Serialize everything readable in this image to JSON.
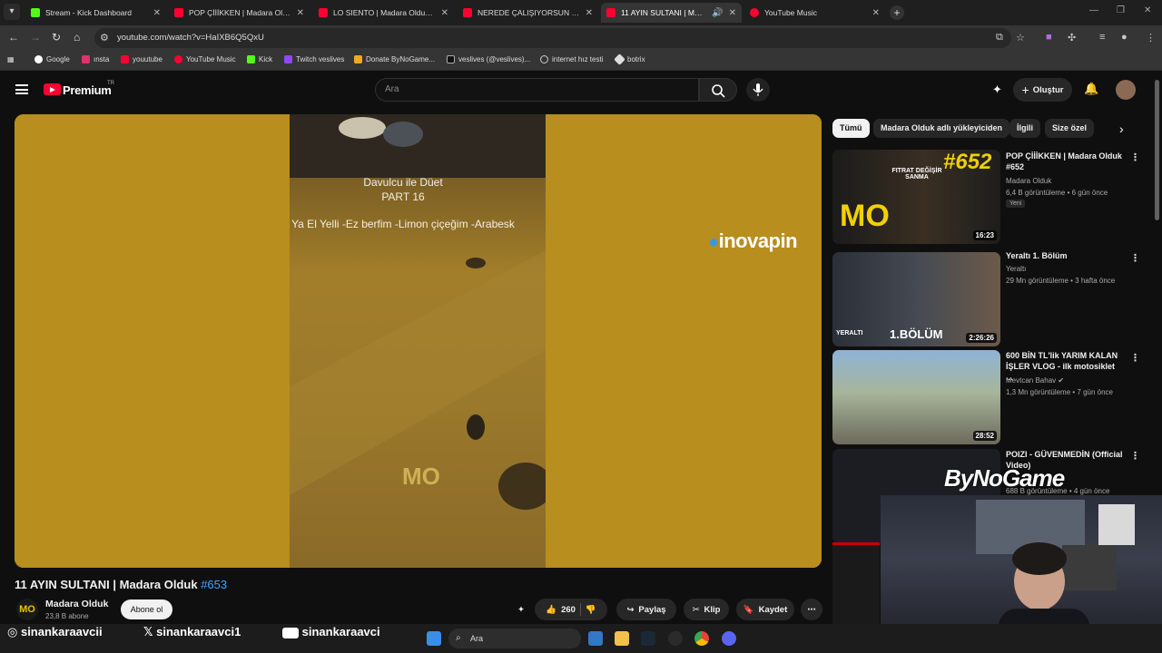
{
  "browser": {
    "tabs": [
      {
        "title": "Stream - Kick Dashboard",
        "favicon": "kick-icon",
        "active": false
      },
      {
        "title": "POP ÇİİİKKEN | Madara Olduk #",
        "favicon": "youtube-icon",
        "active": false
      },
      {
        "title": "LO SIENTO | Madara Olduk #65",
        "favicon": "youtube-icon",
        "active": false
      },
      {
        "title": "NEREDE ÇALIŞIYORSUN | Mada",
        "favicon": "youtube-icon",
        "active": false
      },
      {
        "title": "11 AYIN SULTANI | Madara",
        "favicon": "youtube-icon",
        "active": true
      },
      {
        "title": "YouTube Music",
        "favicon": "youtube-music-icon",
        "active": false
      }
    ],
    "url": "youtube.com/watch?v=HaIXB6Q5QxU",
    "bookmarks": [
      {
        "label": "Google",
        "icon": "google-icon"
      },
      {
        "label": "ınsta",
        "icon": "instagram-icon"
      },
      {
        "label": "youutube",
        "icon": "youtube-icon"
      },
      {
        "label": "YouTube Music",
        "icon": "youtube-music-icon"
      },
      {
        "label": "Kick",
        "icon": "kick-icon"
      },
      {
        "label": "Twitch veslives",
        "icon": "twitch-icon"
      },
      {
        "label": "Donate ByNoGame...",
        "icon": "bynogame-icon"
      },
      {
        "label": "veslives (@veslives)...",
        "icon": "tiktok-icon"
      },
      {
        "label": "internet hız testi",
        "icon": "speedtest-icon"
      },
      {
        "label": "botrix",
        "icon": "botrix-icon"
      }
    ]
  },
  "youtube": {
    "logo_text": "Premium",
    "region": "TR",
    "search_placeholder": "Ara",
    "create_label": "Oluştur"
  },
  "video": {
    "overlay_line1": "Davulcu ile Düet",
    "overlay_line2": "PART 16",
    "overlay_line3": "Ya El Yelli -Ez berfim -Limon çiçeğim -Arabesk",
    "sponsor_watermark": "inovapin",
    "channel_watermark": "MO",
    "title": "11 AYIN SULTANI | Madara Olduk",
    "title_tag": "#653",
    "channel_name": "Madara Olduk",
    "channel_logo": "MO",
    "subscribers": "23,8 B abone",
    "subscribe_label": "Abone ol",
    "likes": "260",
    "share_label": "Paylaş",
    "clip_label": "Klip",
    "save_label": "Kaydet"
  },
  "chips": [
    "Tümü",
    "Madara Olduk adlı yükleyiciden",
    "İlgili",
    "Size özel"
  ],
  "recommendations": [
    {
      "title": "POP ÇİİİKKEN | Madara Olduk #652",
      "channel": "Madara Olduk",
      "meta": "6,4 B görüntüleme • 6 gün önce",
      "badge": "Yeni",
      "duration": "16:23",
      "thumb_text": "#652",
      "thumb_sub": "FITRAT DEĞİŞİR SANMA"
    },
    {
      "title": "Yeraltı 1. Bölüm",
      "channel": "Yeraltı",
      "meta": "29 Mn görüntüleme • 3 hafta önce",
      "duration": "2:26:26",
      "thumb_text": "1.BÖLÜM",
      "thumb_sub": "YERALTI"
    },
    {
      "title": "600 BİN TL'lik YARIM KALAN İŞLER VLOG - ilk motosiklet ...",
      "channel": "Mevtcan Bahav",
      "meta": "1,3 Mn görüntüleme • 7 gün önce",
      "duration": "28:52"
    },
    {
      "title": "POIZI - GÜVENMEDİN (Official Video)",
      "channel": "",
      "meta": "688 B görüntüleme • 4 gün önce"
    }
  ],
  "stream_overlay": {
    "sponsor": "ByNoGame",
    "socials": [
      {
        "icon": "instagram-icon",
        "handle": "sinankaraavcii"
      },
      {
        "icon": "x-icon",
        "handle": "sinankaraavci1"
      },
      {
        "icon": "youtube-icon",
        "handle": "sinankaraavci"
      }
    ]
  },
  "taskbar": {
    "search_placeholder": "Ara"
  },
  "colors": {
    "youtube_red": "#ff0033",
    "kick_green": "#53fc18",
    "link_blue": "#3ea6ff"
  }
}
